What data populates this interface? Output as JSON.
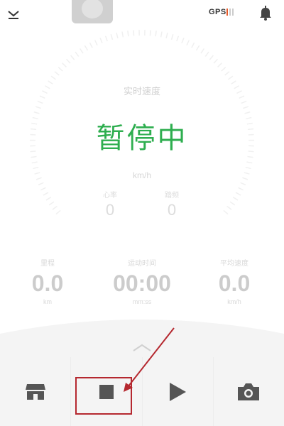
{
  "header": {
    "gps_label": "GPS",
    "gps_signal_bars_on": 1,
    "gps_signal_bars_total": 3,
    "icons": [
      "chevron-down-icon",
      "bell-icon"
    ]
  },
  "speed": {
    "label": "实时速度",
    "status": "暂停中",
    "unit": "km/h"
  },
  "vitals": [
    {
      "label": "心率",
      "value": "0"
    },
    {
      "label": "踏频",
      "value": "0"
    }
  ],
  "stats": [
    {
      "label": "里程",
      "value": "0.0",
      "unit": "km"
    },
    {
      "label": "运动时间",
      "value": "00:00",
      "unit": "mm:ss"
    },
    {
      "label": "平均速度",
      "value": "0.0",
      "unit": "km/h"
    }
  ],
  "nav": {
    "icons": [
      "store-icon",
      "stop-icon",
      "play-icon",
      "camera-icon"
    ]
  },
  "colors": {
    "status_green": "#2eae4f",
    "gps_signal": "#e85a2a",
    "annotation_red": "#b5282f",
    "nav_icon": "#555555"
  }
}
